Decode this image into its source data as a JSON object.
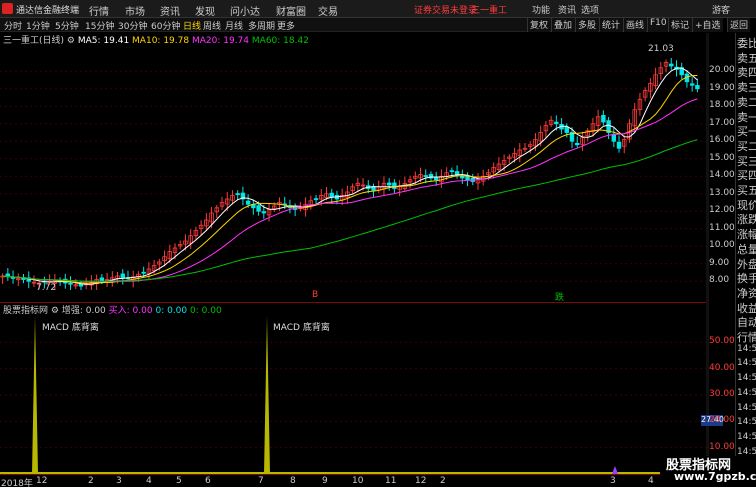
{
  "app": {
    "title": "通达信金融终端"
  },
  "menu": [
    "行情",
    "市场",
    "资讯",
    "发现",
    "问小达",
    "财富圈",
    "交易"
  ],
  "login_status": "证券交易未登录",
  "stock_name_top": "三一重工",
  "top_right": {
    "func": "功能",
    "news": "资讯",
    "options": "选项",
    "guest": "游客"
  },
  "period_tabs": [
    "分时",
    "1分钟",
    "5分钟",
    "15分钟",
    "30分钟",
    "60分钟",
    "日线",
    "周线",
    "月线",
    "多周期",
    "更多"
  ],
  "active_period": "日线",
  "right_tools": [
    "复权",
    "叠加",
    "多股",
    "统计",
    "画线",
    "F10",
    "标记",
    "+自选",
    "返回"
  ],
  "ma_bar": {
    "stock": "三一重工(日线)",
    "ma5": "MA5: 19.41",
    "ma10": "MA10: 19.78",
    "ma20": "MA20: 19.74",
    "ma60": "MA60: 18.42"
  },
  "price_axis": [
    "20.00",
    "19.00",
    "18.00",
    "17.00",
    "16.00",
    "15.00",
    "14.00",
    "13.00",
    "12.00",
    "11.00",
    "10.00",
    "9.00",
    "8.00"
  ],
  "annotations": {
    "high": "21.03",
    "low": "7.72",
    "buy_marker": "B",
    "sell_marker": "跌"
  },
  "indicator_bar": {
    "name": "股票指标网",
    "zengqiang": "增强: 0.00",
    "buy": "买入: 0.00",
    "a": "0: 0.00",
    "b": "0: 0.00"
  },
  "indicator_labels": [
    "MACD 底背离",
    "MACD 底背离"
  ],
  "indicator_axis": [
    "50.00",
    "40.00",
    "30.00",
    "20.00",
    "10.00"
  ],
  "indicator_current": "27.40",
  "dates": [
    "2018年",
    "12",
    "2",
    "3",
    "4",
    "5",
    "6",
    "7",
    "8",
    "9",
    "10",
    "11",
    "12",
    "2",
    "3",
    "4"
  ],
  "right_panel_labels": [
    "委比",
    "卖五",
    "卖四",
    "卖三",
    "卖二",
    "卖一",
    "买一",
    "买二",
    "买三",
    "买四",
    "买五",
    "现价",
    "涨跌",
    "涨幅",
    "总量",
    "外盘",
    "换手",
    "净资",
    "收益",
    "自动",
    "行情",
    "14:5",
    "14:5",
    "14:5",
    "14:5",
    "14:5",
    "14:5",
    "14:5",
    "14:5"
  ],
  "watermark": {
    "title": "股票指标网",
    "url": "www.7gpzb.com"
  },
  "colors": {
    "up": "#ff3b3b",
    "down": "#00e5e5",
    "ma5": "#ffffff",
    "ma10": "#ffd500",
    "ma20": "#ff33ff",
    "ma60": "#00c000",
    "indicator": "#b8b800"
  },
  "chart_data": {
    "type": "candlestick",
    "closes": [
      8.3,
      8.25,
      8.2,
      8.15,
      8.1,
      8.0,
      7.95,
      7.9,
      7.95,
      8.0,
      8.05,
      8.0,
      7.9,
      7.85,
      7.8,
      7.72,
      7.85,
      7.95,
      8.1,
      8.0,
      8.1,
      8.2,
      8.3,
      8.2,
      8.15,
      8.25,
      8.4,
      8.5,
      8.7,
      8.9,
      9.1,
      9.4,
      9.7,
      9.9,
      10.1,
      10.3,
      10.6,
      10.9,
      11.2,
      11.5,
      11.9,
      12.2,
      12.5,
      12.7,
      12.9,
      13.0,
      12.7,
      12.4,
      12.2,
      12.0,
      11.9,
      12.1,
      12.3,
      12.5,
      12.4,
      12.2,
      12.1,
      12.2,
      12.4,
      12.6,
      12.7,
      12.9,
      13.0,
      12.8,
      12.7,
      12.9,
      13.1,
      13.4,
      13.6,
      13.5,
      13.3,
      13.2,
      13.4,
      13.6,
      13.5,
      13.3,
      13.4,
      13.6,
      13.8,
      14.0,
      14.1,
      14.0,
      13.9,
      13.8,
      14.0,
      14.2,
      14.3,
      14.1,
      13.9,
      13.8,
      13.7,
      13.8,
      14.0,
      14.2,
      14.5,
      14.7,
      14.9,
      15.1,
      15.3,
      15.5,
      15.6,
      15.8,
      16.1,
      16.5,
      16.9,
      17.2,
      17.0,
      16.7,
      16.5,
      16.0,
      15.8,
      16.2,
      16.6,
      17.0,
      17.4,
      17.1,
      16.5,
      16.0,
      15.6,
      16.1,
      17.0,
      17.8,
      18.4,
      18.9,
      19.3,
      19.8,
      20.2,
      20.5,
      20.3,
      20.1,
      19.8,
      19.4,
      19.2,
      19.0
    ],
    "ylim": [
      7.5,
      21.5
    ]
  }
}
